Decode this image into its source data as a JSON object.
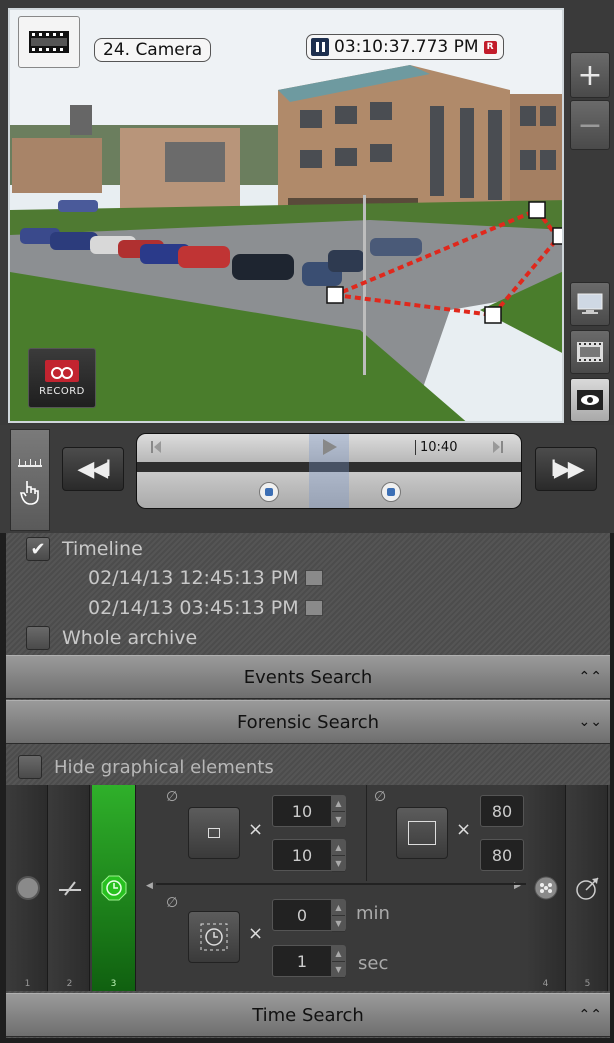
{
  "camera": {
    "name": "24. Camera",
    "timestamp": "03:10:37.773 PM",
    "rec_badge": "R",
    "record_label": "RECORD"
  },
  "side": {
    "zoom_in": "+",
    "zoom_out": "−"
  },
  "timeline": {
    "time_tick": "10:40",
    "back_label": "◀◀I",
    "fwd_label": "I▶▶"
  },
  "search": {
    "timeline_label": "Timeline",
    "date_from": "02/14/13 12:45:13 PM",
    "date_to": "02/14/13 03:45:13 PM",
    "whole_archive_label": "Whole archive",
    "events_search": "Events Search",
    "forensic_search": "Forensic Search",
    "hide_graphical": "Hide graphical elements",
    "time_search": "Time Search"
  },
  "forensic": {
    "tools": [
      "1",
      "2",
      "3",
      "4",
      "5"
    ],
    "min_width": "10",
    "min_height": "10",
    "max_width": "80",
    "max_height": "80",
    "dwell_min": "0",
    "dwell_sec": "1",
    "unit_min": "min",
    "unit_sec": "sec"
  },
  "colors": {
    "accent_green": "#2fb02a",
    "zone_red": "#e0281c"
  }
}
